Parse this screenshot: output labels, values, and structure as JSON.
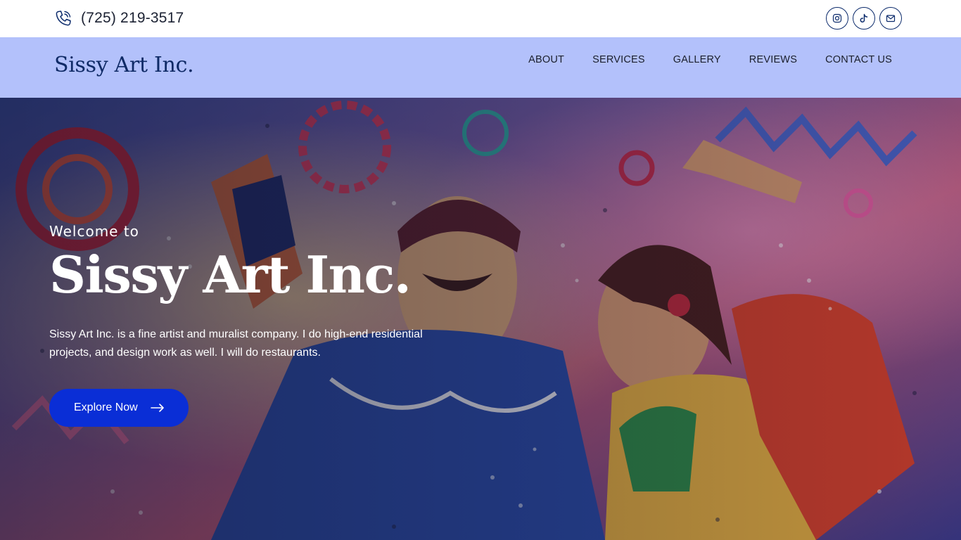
{
  "topbar": {
    "phone_icon": "phone-icon",
    "phone_number": "(725) 219-3517",
    "socials": [
      {
        "name": "instagram-icon"
      },
      {
        "name": "tiktok-icon"
      },
      {
        "name": "email-icon"
      }
    ]
  },
  "header": {
    "logo": "Sissy Art Inc.",
    "nav": [
      "ABOUT",
      "SERVICES",
      "GALLERY",
      "REVIEWS",
      "CONTACT US"
    ]
  },
  "hero": {
    "welcome": "Welcome to",
    "title": "Sissy Art Inc.",
    "description": "Sissy Art Inc. is a fine artist and muralist company. I do high-end residential projects, and design work as well. I will do restaurants.",
    "cta_label": "Explore Now",
    "cta_icon": "arrow-right-icon"
  },
  "colors": {
    "header_bg": "#b3c1fb",
    "logo": "#0f2a66",
    "cta_bg": "#0a2ed6",
    "icon_outline": "#0b2a6b"
  }
}
